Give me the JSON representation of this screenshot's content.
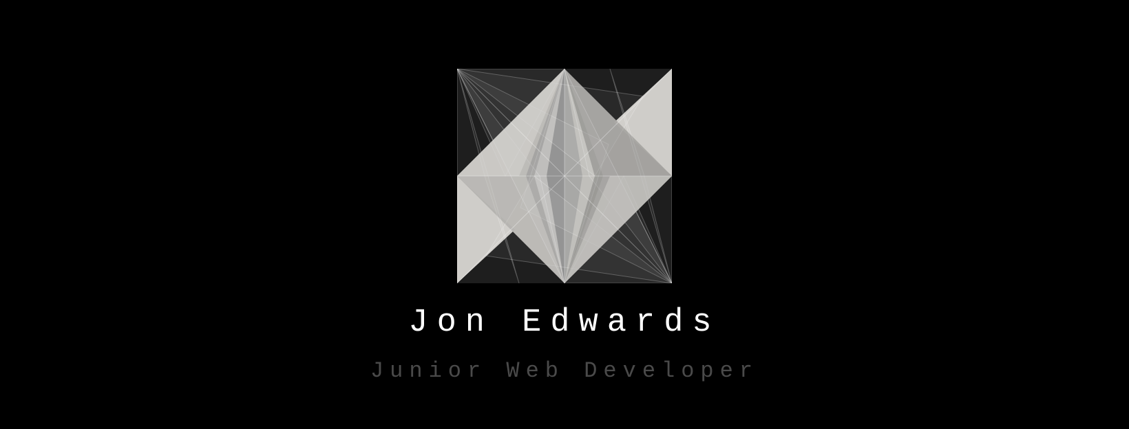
{
  "profile": {
    "name": "Jon Edwards",
    "role": "Junior Web Developer"
  },
  "logo": {
    "icon": "geometric-prism-logo-icon"
  },
  "colors": {
    "background": "#000000",
    "name_text": "#ffffff",
    "role_text": "#4a4a4a",
    "logo_dark": "#1e1e1e",
    "logo_light": "#d2d0cc"
  }
}
